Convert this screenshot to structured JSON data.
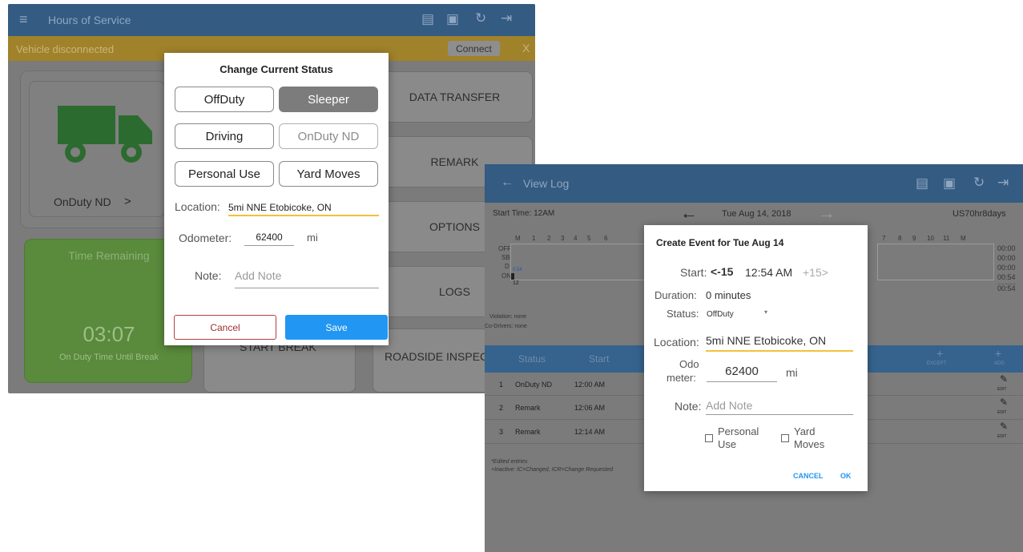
{
  "left": {
    "title": "Hours of Service",
    "banner_text": "Vehicle disconnected",
    "connect_label": "Connect",
    "close_x": "X",
    "status_card_label": "OnDuty ND",
    "status_card_chevron": ">",
    "tiles": [
      "DATA TRANSFER",
      "REMARK",
      "OPTIONS",
      "LOGS",
      "START BREAK",
      "ROADSIDE INSPEC"
    ],
    "time_remaining": {
      "title": "Time Remaining",
      "value": "03:07",
      "caption": "On Duty Time Until Break"
    },
    "dialog": {
      "title": "Change Current Status",
      "buttons": [
        {
          "label": "OffDuty",
          "state": "normal"
        },
        {
          "label": "Sleeper",
          "state": "selected"
        },
        {
          "label": "Driving",
          "state": "normal"
        },
        {
          "label": "OnDuty ND",
          "state": "disabled"
        },
        {
          "label": "Personal Use",
          "state": "normal"
        },
        {
          "label": "Yard Moves",
          "state": "normal"
        }
      ],
      "location_label": "Location:",
      "location_value": "5mi NNE Etobicoke, ON",
      "odometer_label": "Odometer:",
      "odometer_value": "62400",
      "odometer_unit": "mi",
      "note_label": "Note:",
      "note_placeholder": "Add Note",
      "cancel_label": "Cancel",
      "save_label": "Save"
    }
  },
  "right": {
    "title": "View Log",
    "start_time": "Start Time: 12AM",
    "date": "Tue Aug 14, 2018",
    "cycle": "US70hr8days",
    "grid_rows": [
      "OFF",
      "SB",
      "D",
      "ON"
    ],
    "grid_hours": [
      "M",
      "1",
      "2",
      "3",
      "4",
      "5",
      "6",
      "7",
      "8",
      "9",
      "10",
      "11",
      "M"
    ],
    "grid_totals": [
      "00:00",
      "00:00",
      "00:00",
      "00:54",
      "00:54"
    ],
    "grid_mark": "0:54",
    "grid_flag": "12",
    "violation": "Violation: none",
    "codrivers": "Co-Drivers: none",
    "table_headers": {
      "status": "Status",
      "start": "Start",
      "except": "EXCEPT",
      "add": "ADD"
    },
    "rows": [
      {
        "num": "1",
        "status": "OnDuty ND",
        "start": "12:00 AM",
        "action": "EDIT"
      },
      {
        "num": "2",
        "status": "Remark",
        "start": "12:06 AM",
        "action": "EDIT"
      },
      {
        "num": "3",
        "status": "Remark",
        "start": "12:14 AM",
        "action": "EDIT"
      }
    ],
    "footnote1": "*Edited entries",
    "footnote2": "+Inactive: IC=Changed, ICR=Change Requested",
    "dialog": {
      "title": "Create Event for Tue Aug 14",
      "start_label": "Start:",
      "minus": "<-15",
      "start_time": "12:54 AM",
      "plus": "+15>",
      "duration_label": "Duration:",
      "duration_value": "0 minutes",
      "status_label": "Status:",
      "status_value": "OffDuty",
      "location_label": "Location:",
      "location_value": "5mi NNE Etobicoke, ON",
      "odo_label_1": "Odo",
      "odo_label_2": "meter:",
      "odo_value": "62400",
      "odo_unit": "mi",
      "note_label": "Note:",
      "note_placeholder": "Add Note",
      "personal_use_1": "Personal",
      "personal_use_2": "Use",
      "yard_moves_1": "Yard",
      "yard_moves_2": "Moves",
      "cancel_label": "CANCEL",
      "ok_label": "OK"
    }
  },
  "colors": {
    "topbar": "#345b82",
    "banner": "#a0822a",
    "accent_blue": "#2196f3",
    "underline_yellow": "#f0c23c",
    "truck_green": "#2e7d32"
  }
}
